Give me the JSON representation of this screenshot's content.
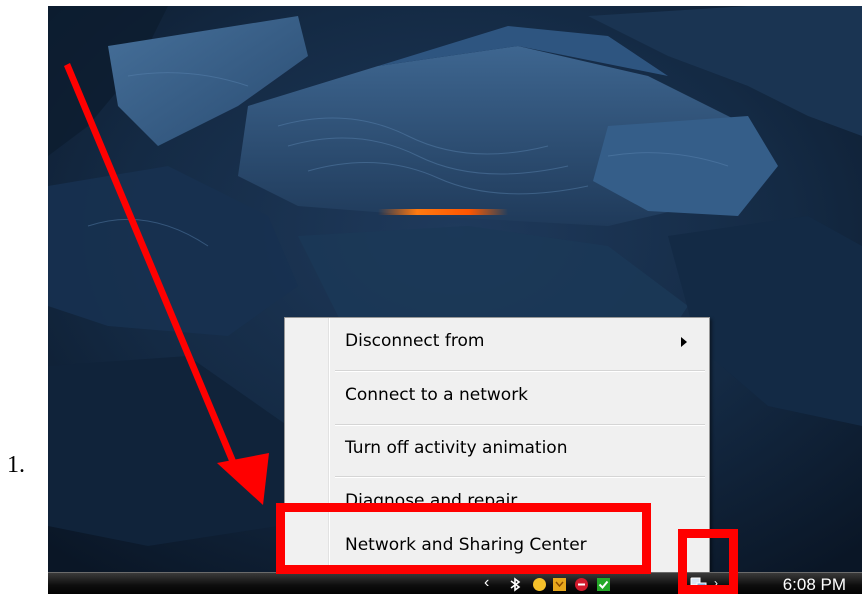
{
  "step_number": "1.",
  "context_menu": {
    "items": [
      {
        "label": "Disconnect from",
        "has_submenu": true
      },
      {
        "label": "Connect to a network",
        "has_submenu": false
      },
      {
        "label": "Turn off activity animation",
        "has_submenu": false
      },
      {
        "label": "Diagnose and repair",
        "has_submenu": false
      },
      {
        "label": "Network and Sharing Center",
        "has_submenu": false
      }
    ]
  },
  "taskbar": {
    "clock": "6:08 PM",
    "tray_icons": [
      "show-hidden-chevron",
      "bluetooth-icon",
      "emoticon-icon",
      "shield-icon",
      "stop-icon",
      "checkmark-icon",
      "network-icon",
      "volume-icon"
    ]
  },
  "annotations": {
    "highlight_color": "#ff0000",
    "highlighted_item": "Network and Sharing Center",
    "highlighted_tray_icon": "network-icon"
  }
}
